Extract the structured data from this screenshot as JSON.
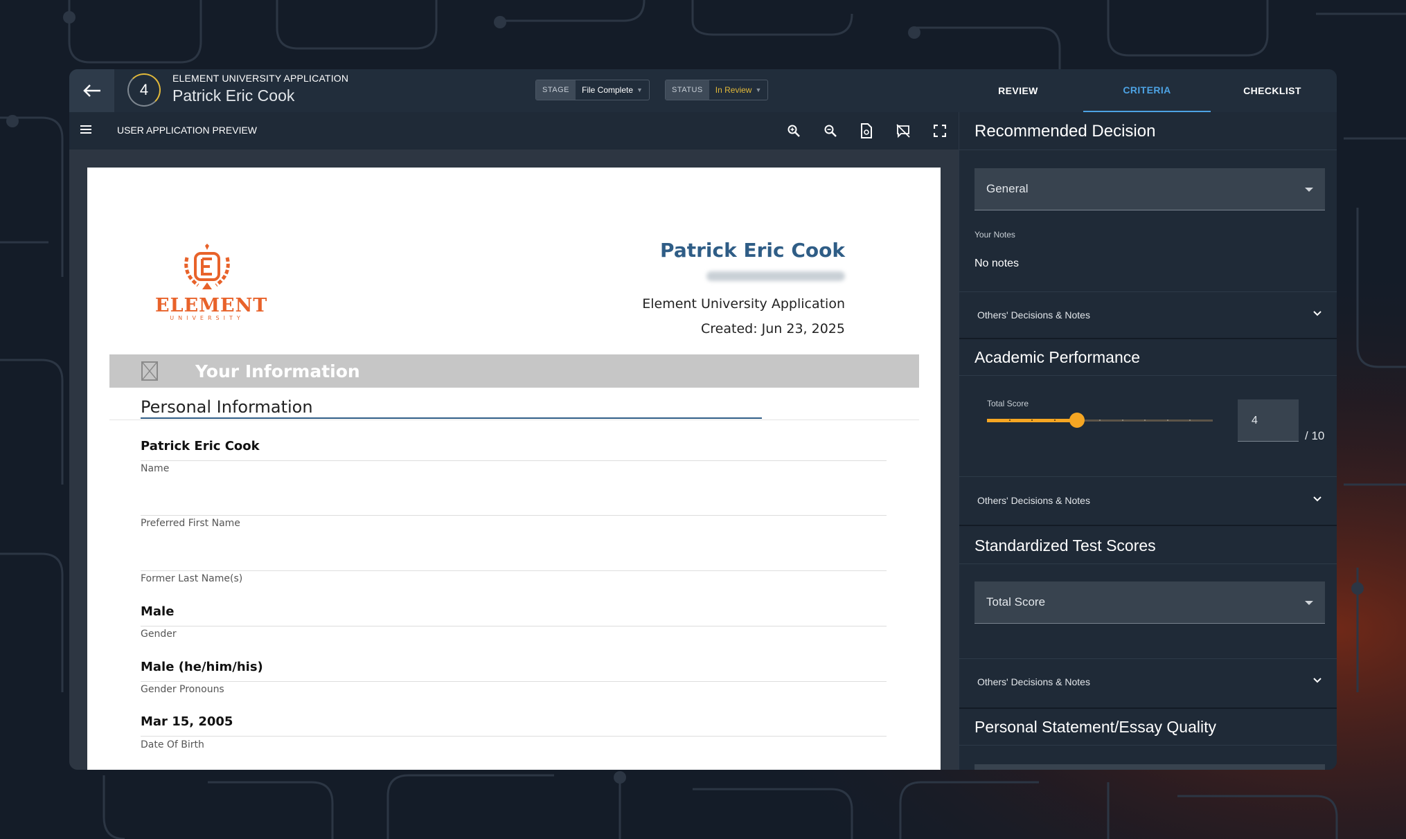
{
  "header": {
    "step_number": "4",
    "app_title": "ELEMENT UNIVERSITY APPLICATION",
    "applicant_name": "Patrick Eric Cook",
    "stage_label": "STAGE",
    "stage_value": "File Complete",
    "status_label": "STATUS",
    "status_value": "In Review",
    "tabs": [
      {
        "label": "REVIEW",
        "active": false
      },
      {
        "label": "CRITERIA",
        "active": true
      },
      {
        "label": "CHECKLIST",
        "active": false
      }
    ]
  },
  "toolbar": {
    "title": "USER APPLICATION PREVIEW",
    "tools": [
      "zoom-in-icon",
      "zoom-out-icon",
      "document-search-icon",
      "hide-comments-icon",
      "fullscreen-icon"
    ]
  },
  "document": {
    "logo_text": "ELEMENT",
    "logo_subtext": "UNIVERSITY",
    "name": "Patrick Eric Cook",
    "application_title": "Element University Application",
    "created": "Created: Jun 23, 2025",
    "section_band": "Your Information",
    "section_title": "Personal Information",
    "fields": [
      {
        "value": "Patrick Eric Cook",
        "label": "Name"
      },
      {
        "value": "",
        "label": "Preferred First Name"
      },
      {
        "value": "",
        "label": "Former Last Name(s)"
      },
      {
        "value": "Male",
        "label": "Gender"
      },
      {
        "value": "Male (he/him/his)",
        "label": "Gender Pronouns"
      },
      {
        "value": "Mar 15, 2005",
        "label": "Date Of Birth"
      }
    ]
  },
  "criteria": {
    "recommended": {
      "title": "Recommended Decision",
      "select_value": "General",
      "notes_label": "Your Notes",
      "notes_value": "No notes",
      "others": "Others' Decisions & Notes"
    },
    "academic": {
      "title": "Academic Performance",
      "score_label": "Total Score",
      "score_value": "4",
      "score_max": "/ 10",
      "slider_value": 4,
      "slider_max": 10,
      "others": "Others' Decisions & Notes"
    },
    "standardized": {
      "title": "Standardized Test Scores",
      "select_value": "Total Score",
      "others": "Others' Decisions & Notes"
    },
    "essay": {
      "title": "Personal Statement/Essay Quality"
    }
  },
  "colors": {
    "accent": "#4da3e4",
    "slider": "#f5a623",
    "status": "#e2b93a",
    "brand_orange": "#e8622a",
    "doc_name": "#2f5d86"
  }
}
